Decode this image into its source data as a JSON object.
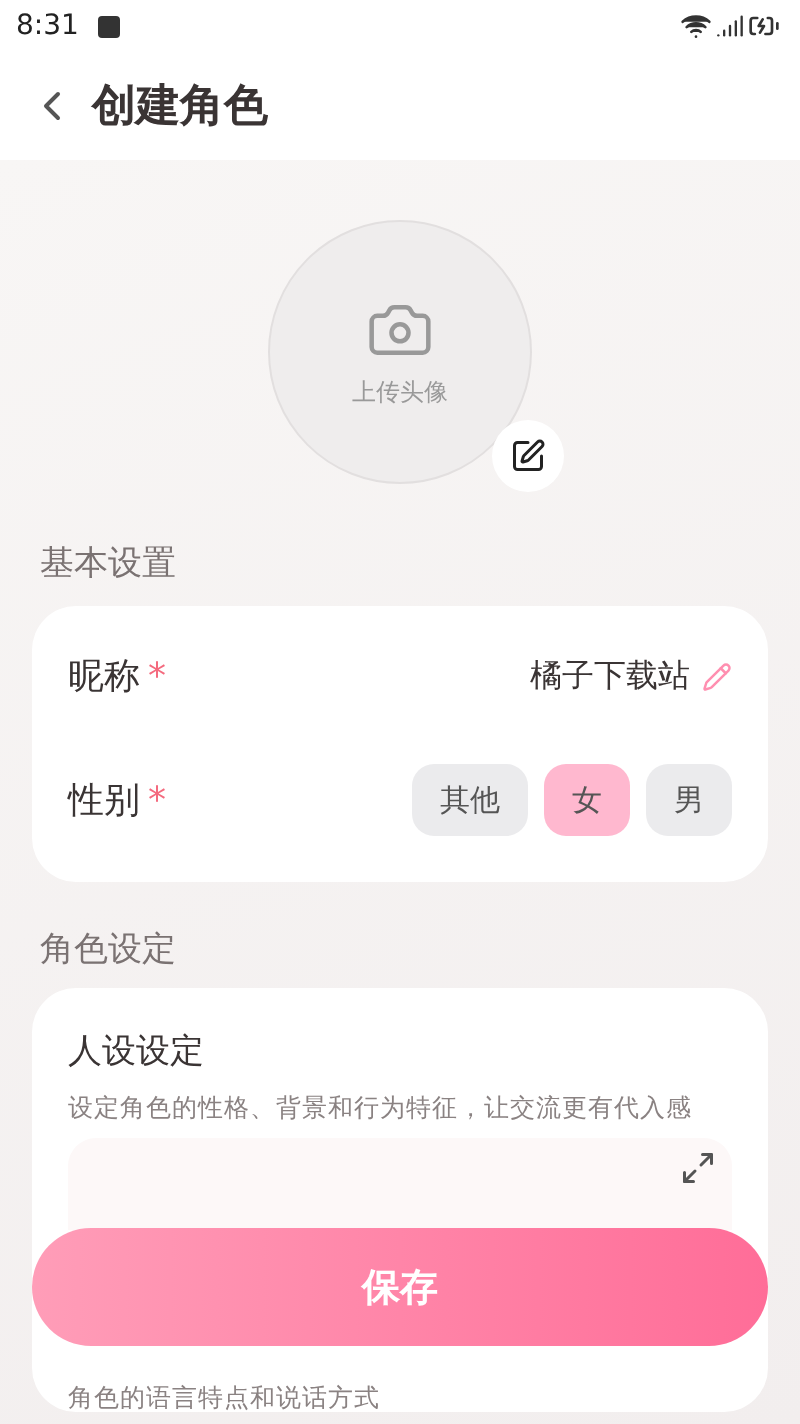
{
  "status_bar": {
    "time": "8:31"
  },
  "header": {
    "title": "创建角色"
  },
  "avatar": {
    "label": "上传头像"
  },
  "basic": {
    "title": "基本设置",
    "nickname": {
      "label": "昵称",
      "required_mark": "*",
      "value": "橘子下载站"
    },
    "gender": {
      "label": "性别",
      "required_mark": "*",
      "options": [
        {
          "label": "其他",
          "selected": false
        },
        {
          "label": "女",
          "selected": true
        },
        {
          "label": "男",
          "selected": false
        }
      ]
    }
  },
  "role": {
    "title": "角色设定",
    "persona": {
      "title": "人设设定",
      "description": "设定角色的性格、背景和行为特征，让交流更有代入感"
    },
    "style": {
      "description": "角色的语言特点和说话方式"
    }
  },
  "save_button": "保存"
}
